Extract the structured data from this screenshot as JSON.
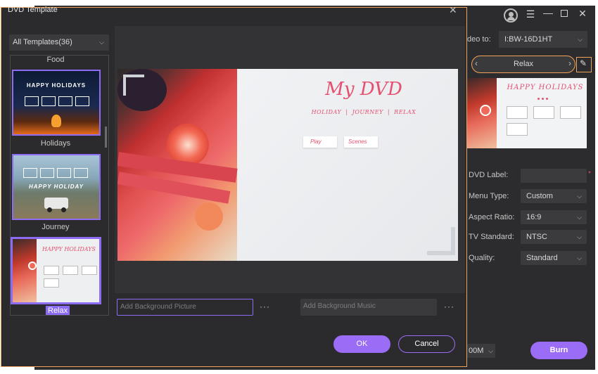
{
  "dialog": {
    "title": "DVD Template",
    "close_icon": "close-icon",
    "template_filter": "All Templates(36)",
    "templates": [
      {
        "label": "Food"
      },
      {
        "label": "Holidays",
        "thumb_text": "HAPPY HOLIDAYS"
      },
      {
        "label": "Journey",
        "thumb_text": "HAPPY HOLIDAY"
      },
      {
        "label": "Relax",
        "thumb_text": "HAPPY HOLIDAYS",
        "selected": true
      }
    ],
    "preview": {
      "title": "My DVD",
      "subtitle": "HOLIDAY  |  JOURNEY  |  RELAX",
      "play": "Play",
      "scenes": "Scenes"
    },
    "bg_picture_placeholder": "Add Background Picture",
    "bg_music_placeholder": "Add Background Music",
    "more_label": "···",
    "ok": "OK",
    "cancel": "Cancel"
  },
  "main": {
    "video_to_label": "deo to:",
    "video_to_value": "I:BW-16D1HT",
    "template_name": "Relax",
    "thumb_title": "HAPPY HOLIDAYS",
    "fields": [
      {
        "label": "DVD Label:",
        "value": ""
      },
      {
        "label": "Menu Type:",
        "value": "Custom"
      },
      {
        "label": "Aspect Ratio:",
        "value": "16:9"
      },
      {
        "label": "TV Standard:",
        "value": "NTSC"
      },
      {
        "label": "Quality:",
        "value": "Standard"
      }
    ],
    "size_value": "00M",
    "burn": "Burn"
  },
  "colors": {
    "accent": "#9b6cf5",
    "highlight": "#f0a35a",
    "title_pink": "#e4506f"
  }
}
